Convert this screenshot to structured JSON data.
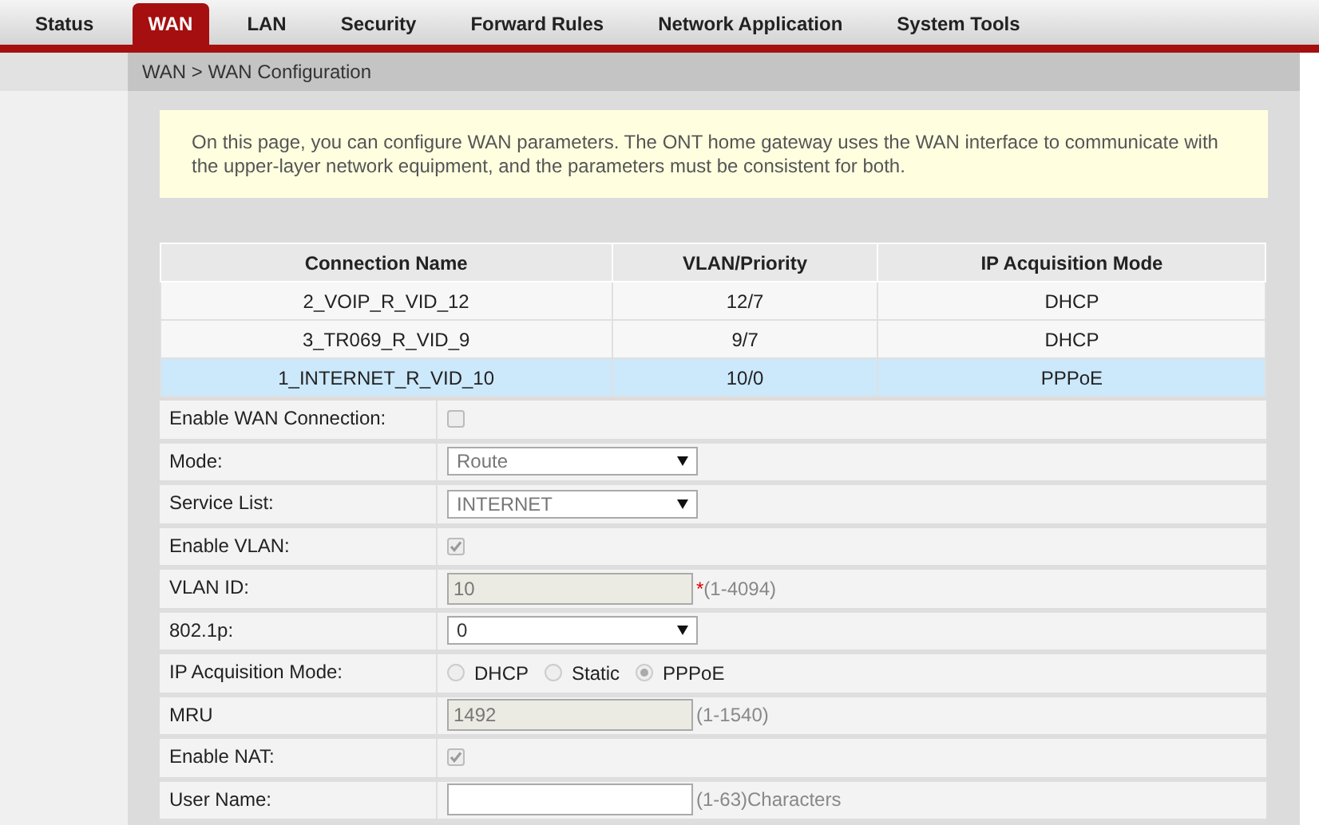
{
  "tabs": [
    {
      "label": "Status",
      "selected": false
    },
    {
      "label": "WAN",
      "selected": true
    },
    {
      "label": "LAN",
      "selected": false
    },
    {
      "label": "Security",
      "selected": false
    },
    {
      "label": "Forward Rules",
      "selected": false
    },
    {
      "label": "Network Application",
      "selected": false
    },
    {
      "label": "System Tools",
      "selected": false
    }
  ],
  "breadcrumb": "WAN > WAN Configuration",
  "notice": "On this page, you can configure WAN parameters. The ONT home gateway uses the WAN interface to communicate with the upper-layer network equipment, and the parameters must be consistent for both.",
  "table": {
    "columns": [
      "Connection Name",
      "VLAN/Priority",
      "IP Acquisition Mode"
    ],
    "rows": [
      {
        "cells": [
          "2_VOIP_R_VID_12",
          "12/7",
          "DHCP"
        ],
        "selected": false
      },
      {
        "cells": [
          "3_TR069_R_VID_9",
          "9/7",
          "DHCP"
        ],
        "selected": false
      },
      {
        "cells": [
          "1_INTERNET_R_VID_10",
          "10/0",
          "PPPoE"
        ],
        "selected": true
      }
    ]
  },
  "form": [
    {
      "kind": "checkbox",
      "label": "Enable WAN Connection:",
      "checked": false
    },
    {
      "kind": "select",
      "label": "Mode:",
      "value": "Route",
      "disabled": true
    },
    {
      "kind": "select",
      "label": "Service List:",
      "value": "INTERNET",
      "disabled": true
    },
    {
      "kind": "checkbox",
      "label": "Enable VLAN:",
      "checked": true
    },
    {
      "kind": "text",
      "label": "VLAN ID:",
      "value": "10",
      "disabled": true,
      "mark": "*",
      "hint": "(1-4094)"
    },
    {
      "kind": "select",
      "label": "802.1p:",
      "value": "0",
      "disabled": false
    },
    {
      "kind": "radio",
      "label": "IP Acquisition Mode:",
      "options": [
        {
          "label": "DHCP",
          "selected": false
        },
        {
          "label": "Static",
          "selected": false
        },
        {
          "label": "PPPoE",
          "selected": true
        }
      ]
    },
    {
      "kind": "text",
      "label": "MRU",
      "value": "1492",
      "disabled": true,
      "hint": "(1-1540)"
    },
    {
      "kind": "checkbox",
      "label": "Enable NAT:",
      "checked": true
    },
    {
      "kind": "text",
      "label": "User Name:",
      "disabled": false,
      "hint": "(1-63)Characters"
    }
  ]
}
